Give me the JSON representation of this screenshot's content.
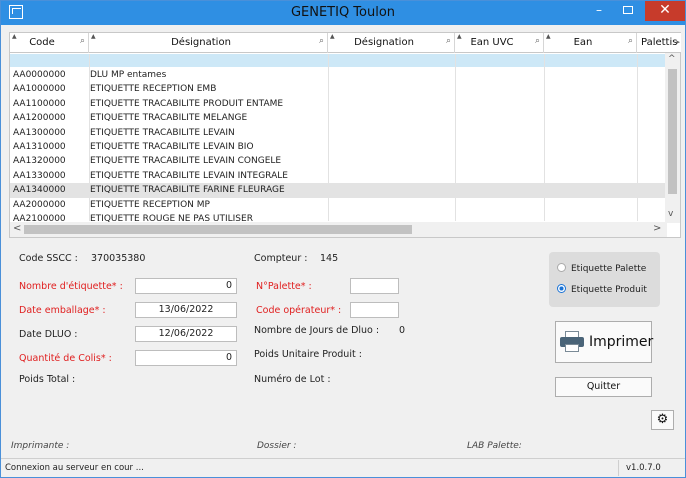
{
  "window": {
    "title": "GENETIQ Toulon",
    "minimize": "–",
    "close": "✕"
  },
  "grid": {
    "columns": [
      "Code",
      "Désignation",
      "Désignation",
      "Ean UVC",
      "Ean",
      "Palettis"
    ],
    "rows": [
      {
        "code": "AA0000000",
        "designation": "DLU MP entames"
      },
      {
        "code": "AA1000000",
        "designation": "ETIQUETTE RECEPTION EMB"
      },
      {
        "code": "AA1100000",
        "designation": "ETIQUETTE TRACABILITE PRODUIT ENTAME"
      },
      {
        "code": "AA1200000",
        "designation": "ETIQUETTE TRACABILITE MELANGE"
      },
      {
        "code": "AA1300000",
        "designation": "ETIQUETTE TRACABILITE LEVAIN"
      },
      {
        "code": "AA1310000",
        "designation": "ETIQUETTE TRACABILITE LEVAIN BIO"
      },
      {
        "code": "AA1320000",
        "designation": "ETIQUETTE TRACABILITE LEVAIN CONGELE"
      },
      {
        "code": "AA1330000",
        "designation": "ETIQUETTE TRACABILITE LEVAIN INTEGRALE"
      },
      {
        "code": "AA1340000",
        "designation": "ETIQUETTE TRACABILITE FARINE FLEURAGE"
      },
      {
        "code": "AA2000000",
        "designation": "ETIQUETTE RECEPTION MP"
      },
      {
        "code": "AA2100000",
        "designation": "ETIQUETTE ROUGE NE PAS UTILISER"
      }
    ],
    "scroll": {
      "up": "^",
      "down": "v",
      "left": "<",
      "right": ">",
      "header_right": "▸"
    }
  },
  "form": {
    "code_sscc_label": "Code SSCC :",
    "code_sscc_value": "370035380",
    "compteur_label": "Compteur :",
    "compteur_value": "145",
    "nombre_etiquette_label": "Nombre d'étiquette* :",
    "nombre_etiquette_value": "0",
    "date_emballage_label": "Date emballage* :",
    "date_emballage_value": "13/06/2022",
    "date_dluo_label": "Date DLUO :",
    "date_dluo_value": "12/06/2022",
    "quantite_colis_label": "Quantité de Colis* :",
    "quantite_colis_value": "0",
    "poids_total_label": "Poids Total :",
    "npalette_label": "N°Palette* :",
    "npalette_value": "",
    "code_operateur_label": "Code opérateur* :",
    "code_operateur_value": "",
    "nb_jours_dluo_label": "Nombre de Jours de Dluo :",
    "nb_jours_dluo_value": "0",
    "poids_unitaire_label": "Poids Unitaire Produit :",
    "numero_lot_label": "Numéro de Lot :"
  },
  "options": {
    "palette_label": "Etiquette Palette",
    "produit_label": "Etiquette Produit",
    "selected": "produit"
  },
  "buttons": {
    "print": "Imprimer",
    "quit": "Quitter",
    "settings": "⚙"
  },
  "footer": {
    "imprimante": "Imprimante :",
    "dossier": "Dossier :",
    "lab_palette": "LAB Palette:"
  },
  "status": {
    "message": "Connexion au serveur en cour ...",
    "version": "v1.0.7.0"
  }
}
